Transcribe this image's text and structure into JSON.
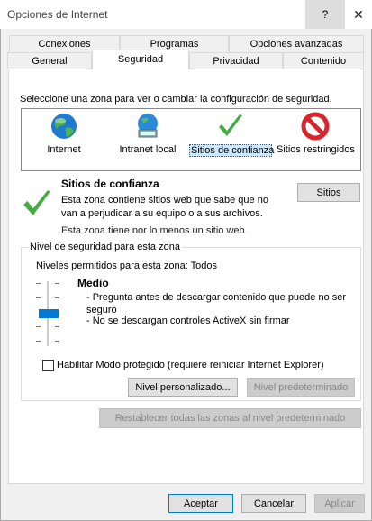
{
  "window": {
    "title": "Opciones de Internet",
    "help_label": "?",
    "close_label": "✕"
  },
  "tabs": {
    "row1": [
      "Conexiones",
      "Programas",
      "Opciones avanzadas"
    ],
    "row2": [
      "General",
      "Seguridad",
      "Privacidad",
      "Contenido"
    ],
    "active": "Seguridad"
  },
  "zones": {
    "instruction": "Seleccione una zona para ver o cambiar la configuración de seguridad.",
    "items": [
      {
        "label": "Internet",
        "icon": "globe-icon"
      },
      {
        "label": "Intranet local",
        "icon": "intranet-icon"
      },
      {
        "label": "Sitios de confianza",
        "icon": "checkmark-icon"
      },
      {
        "label": "Sitios restringidos",
        "icon": "prohibited-icon"
      }
    ],
    "selected": "Sitios de confianza"
  },
  "zone_info": {
    "title": "Sitios de confianza",
    "description": "Esta zona contiene sitios web que sabe que no van a perjudicar a su equipo o a sus archivos.",
    "note": "Esta zona tiene por lo menos un sitio web.",
    "sites_button": "Sitios"
  },
  "security_level": {
    "group_title": "Nivel de seguridad para esta zona",
    "allowed_levels": "Niveles permitidos para esta zona: Todos",
    "level_name": "Medio",
    "bullets": [
      "- Pregunta antes de descargar contenido que puede no ser seguro",
      "- No se descargan controles ActiveX sin firmar"
    ],
    "protected_mode_label": "Habilitar Modo protegido (requiere reiniciar Internet Explorer)",
    "protected_mode_checked": false,
    "custom_level_button": "Nivel personalizado...",
    "default_level_button": "Nivel predeterminado",
    "slider_level": "Medio"
  },
  "reset_all_button": "Restablecer todas las zonas al nivel predeterminado",
  "footer": {
    "ok": "Aceptar",
    "cancel": "Cancelar",
    "apply": "Aplicar"
  },
  "colors": {
    "slider_thumb": "#0078d7",
    "checkmark": "#3fae3f",
    "prohibited": "#d9262c"
  }
}
